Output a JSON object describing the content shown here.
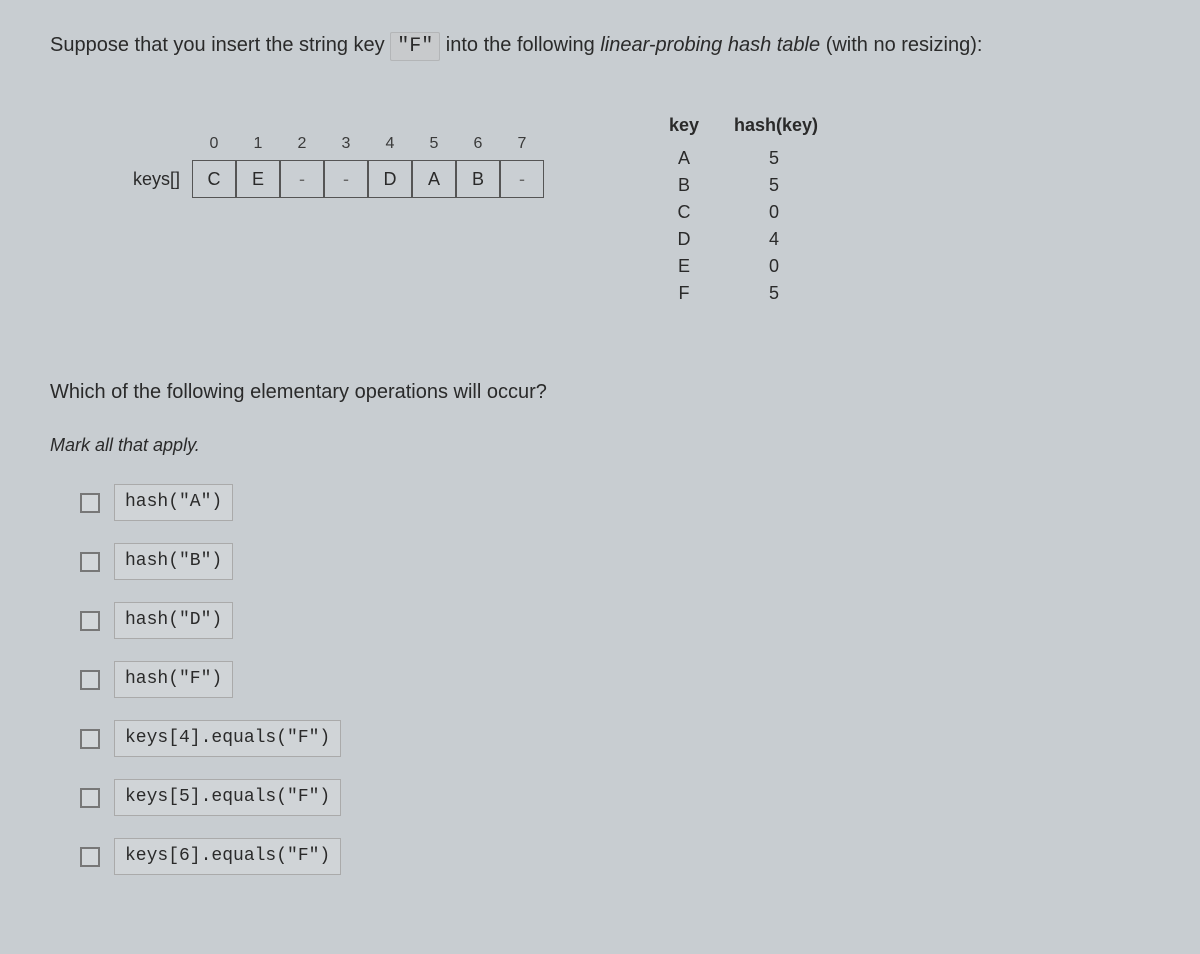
{
  "prompt": {
    "part1": "Suppose that you insert the string key ",
    "key": "\"F\"",
    "part2": " into the following ",
    "italic": "linear-probing hash table",
    "part3": " (with no resizing):"
  },
  "array": {
    "label": "keys[]",
    "indices": [
      "0",
      "1",
      "2",
      "3",
      "4",
      "5",
      "6",
      "7"
    ],
    "cells": [
      "C",
      "E",
      "-",
      "-",
      "D",
      "A",
      "B",
      "-"
    ]
  },
  "hash_table": {
    "header": {
      "key": "key",
      "val": "hash(key)"
    },
    "rows": [
      {
        "key": "A",
        "val": "5"
      },
      {
        "key": "B",
        "val": "5"
      },
      {
        "key": "C",
        "val": "0"
      },
      {
        "key": "D",
        "val": "4"
      },
      {
        "key": "E",
        "val": "0"
      },
      {
        "key": "F",
        "val": "5"
      }
    ]
  },
  "question2": "Which of the following elementary operations will occur?",
  "instructions": "Mark all that apply.",
  "options": [
    "hash(\"A\")",
    "hash(\"B\")",
    "hash(\"D\")",
    "hash(\"F\")",
    "keys[4].equals(\"F\")",
    "keys[5].equals(\"F\")",
    "keys[6].equals(\"F\")"
  ]
}
